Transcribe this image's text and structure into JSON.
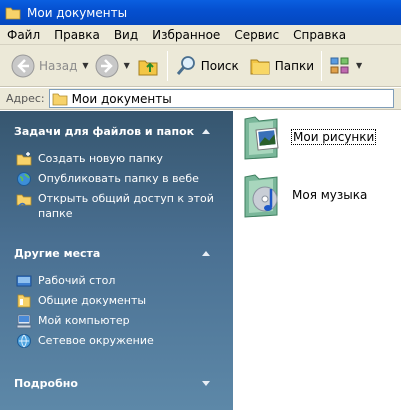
{
  "window": {
    "title": "Мои документы"
  },
  "menu": [
    "Файл",
    "Правка",
    "Вид",
    "Избранное",
    "Сервис",
    "Справка"
  ],
  "toolbar": {
    "back_label": "Назад",
    "search_label": "Поиск",
    "folders_label": "Папки"
  },
  "address": {
    "label": "Адрес:",
    "value": "Мои документы"
  },
  "tasks": {
    "section_title": "Задачи для файлов и папок",
    "items": [
      {
        "label": "Создать новую папку",
        "icon": "new-folder-icon"
      },
      {
        "label": "Опубликовать папку в вебе",
        "icon": "publish-web-icon"
      },
      {
        "label": "Открыть общий доступ к этой папке",
        "icon": "share-folder-icon"
      }
    ]
  },
  "places": {
    "section_title": "Другие места",
    "items": [
      {
        "label": "Рабочий стол",
        "icon": "desktop-icon"
      },
      {
        "label": "Общие документы",
        "icon": "shared-documents-icon"
      },
      {
        "label": "Мой компьютер",
        "icon": "my-computer-icon"
      },
      {
        "label": "Сетевое окружение",
        "icon": "network-places-icon"
      }
    ]
  },
  "details": {
    "section_title": "Подробно"
  },
  "files": [
    {
      "label": "Мои рисунки",
      "icon": "my-pictures-folder-icon"
    },
    {
      "label": "Моя музыка",
      "icon": "my-music-folder-icon"
    }
  ],
  "colors": {
    "title_bar": "#0550d0",
    "chrome": "#ece9d8",
    "task_pane_top": "#36566f",
    "task_pane_bottom": "#5d88a8"
  }
}
